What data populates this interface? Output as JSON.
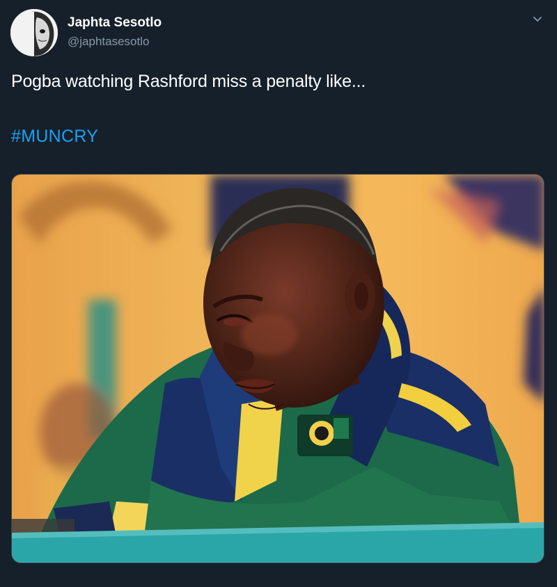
{
  "author": {
    "display_name": "Japhta Sesotlo",
    "handle": "@japhtasesotlo"
  },
  "tweet": {
    "text": "Pogba watching Rashford miss a penalty like...",
    "hashtag": "#MUNCRY"
  },
  "media": {
    "description_icon": "photo-crying-man-in-green-yellow-jacket"
  },
  "colors": {
    "background": "#15202b",
    "text_primary": "#ffffff",
    "text_secondary": "#8899a6",
    "link": "#1da1f2"
  }
}
